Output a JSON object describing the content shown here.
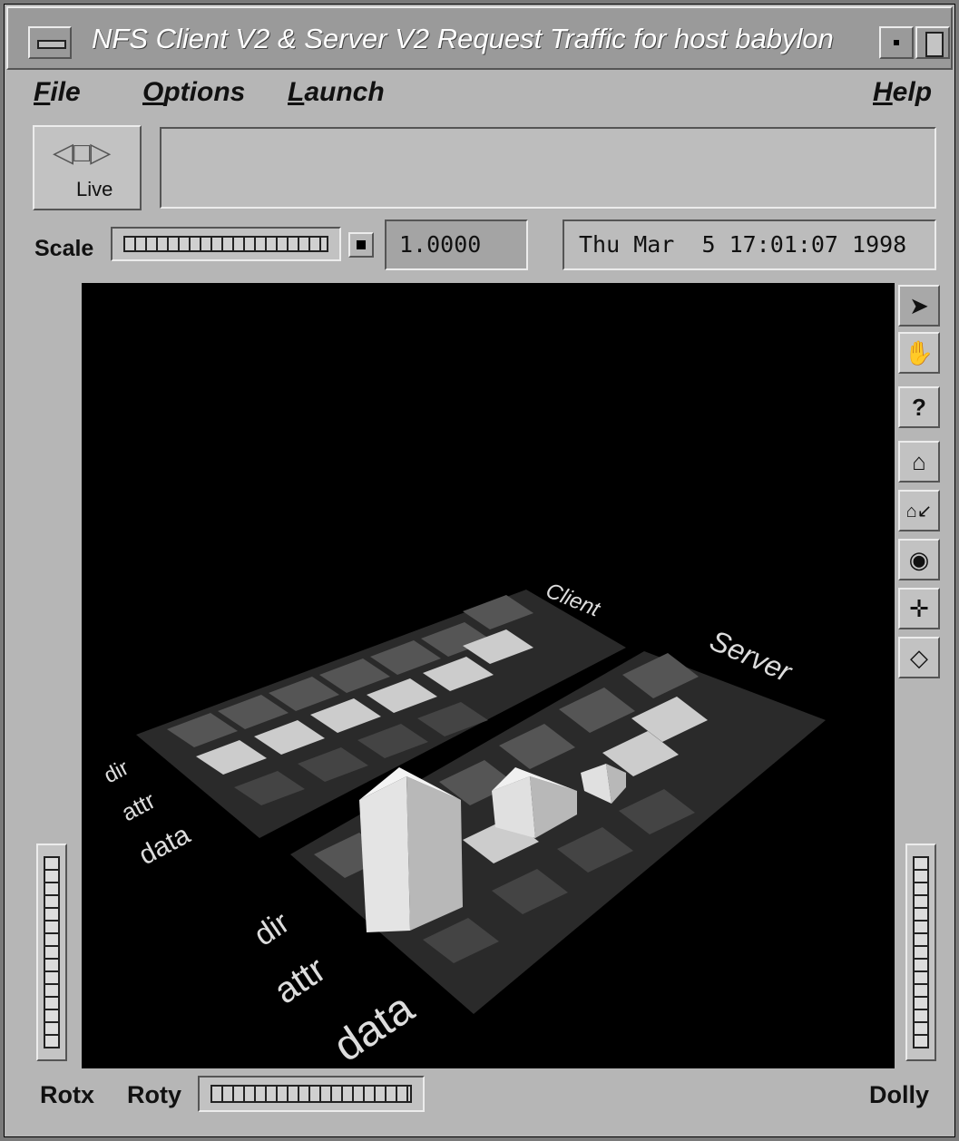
{
  "window": {
    "title": "NFS Client V2 & Server V2 Request Traffic for host babylon"
  },
  "menubar": {
    "items": [
      {
        "label": "File",
        "mnemonic": "F",
        "rest": "ile"
      },
      {
        "label": "Options",
        "mnemonic": "O",
        "rest": "ptions"
      },
      {
        "label": "Launch",
        "mnemonic": "L",
        "rest": "aunch"
      },
      {
        "label": "Help",
        "mnemonic": "H",
        "rest": "elp"
      }
    ]
  },
  "controls": {
    "live_label": "Live",
    "live_arrows": "◁□▷",
    "scale_label": "Scale",
    "scale_value": "1.0000",
    "date": "Thu Mar  5 17:01:07 1998"
  },
  "scene": {
    "client_label": "Client",
    "server_label": "Server",
    "row_labels": [
      "dir",
      "attr",
      "data"
    ]
  },
  "toolbar": {
    "tools": [
      {
        "name": "pick-icon",
        "glyph": "➤",
        "active": true
      },
      {
        "name": "hand-icon",
        "glyph": "✋",
        "active": false
      },
      {
        "name": "help-icon",
        "glyph": "?",
        "active": false
      },
      {
        "name": "home-icon",
        "glyph": "⌂",
        "active": false
      },
      {
        "name": "set-home-icon",
        "glyph": "⌂↙",
        "active": false
      },
      {
        "name": "view-all-icon",
        "glyph": "◉",
        "active": false
      },
      {
        "name": "seek-icon",
        "glyph": "✛",
        "active": false
      },
      {
        "name": "projection-icon",
        "glyph": "◇",
        "active": false
      }
    ]
  },
  "bottom": {
    "rotx": "Rotx",
    "roty": "Roty",
    "dolly": "Dolly"
  }
}
